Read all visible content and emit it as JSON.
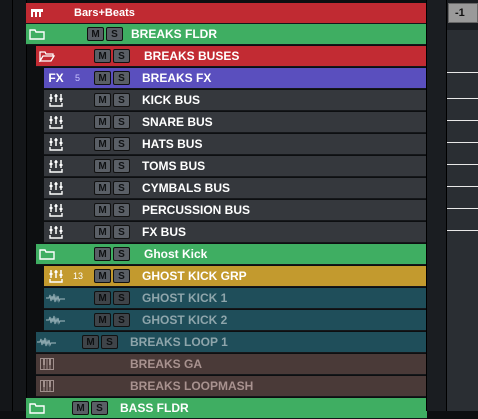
{
  "tracks": [
    {
      "name": "Bars+Beats",
      "type": "ruler",
      "color": "#c02a32"
    },
    {
      "name": "BREAKS FLDR",
      "type": "folder",
      "color": "#3fae62"
    },
    {
      "name": "BREAKS BUSES",
      "type": "folder-open",
      "color": "#c22b33"
    },
    {
      "name": "BREAKS FX",
      "type": "fx",
      "number": "5",
      "color": "#5a4fbe"
    },
    {
      "name": "KICK BUS",
      "type": "group",
      "color": "#35383d"
    },
    {
      "name": "SNARE BUS",
      "type": "group",
      "color": "#35383d"
    },
    {
      "name": "HATS BUS",
      "type": "group",
      "color": "#35383d"
    },
    {
      "name": "TOMS BUS",
      "type": "group",
      "color": "#35383d"
    },
    {
      "name": "CYMBALS BUS",
      "type": "group",
      "color": "#35383d"
    },
    {
      "name": "PERCUSSION BUS",
      "type": "group",
      "color": "#35383d"
    },
    {
      "name": "FX BUS",
      "type": "group",
      "color": "#35383d"
    },
    {
      "name": "Ghost Kick",
      "type": "folder",
      "color": "#3fae62"
    },
    {
      "name": "GHOST KICK GRP",
      "type": "group",
      "number": "13",
      "color": "#c39a2e"
    },
    {
      "name": "GHOST KICK 1",
      "type": "audio",
      "color": "#1f4e5a"
    },
    {
      "name": "GHOST KICK 2",
      "type": "audio",
      "color": "#1f4e5a"
    },
    {
      "name": "BREAKS LOOP 1",
      "type": "audio",
      "color": "#1f4e5a"
    },
    {
      "name": "BREAKS GA",
      "type": "instrument",
      "color": "#4a3a38"
    },
    {
      "name": "BREAKS LOOPMASH",
      "type": "instrument",
      "color": "#4a3a38"
    },
    {
      "name": "BASS FLDR",
      "type": "folder",
      "color": "#3fae62"
    }
  ],
  "buttons": {
    "mute": "M",
    "solo": "S"
  },
  "fx_label": "FX",
  "ruler_position": "-1"
}
